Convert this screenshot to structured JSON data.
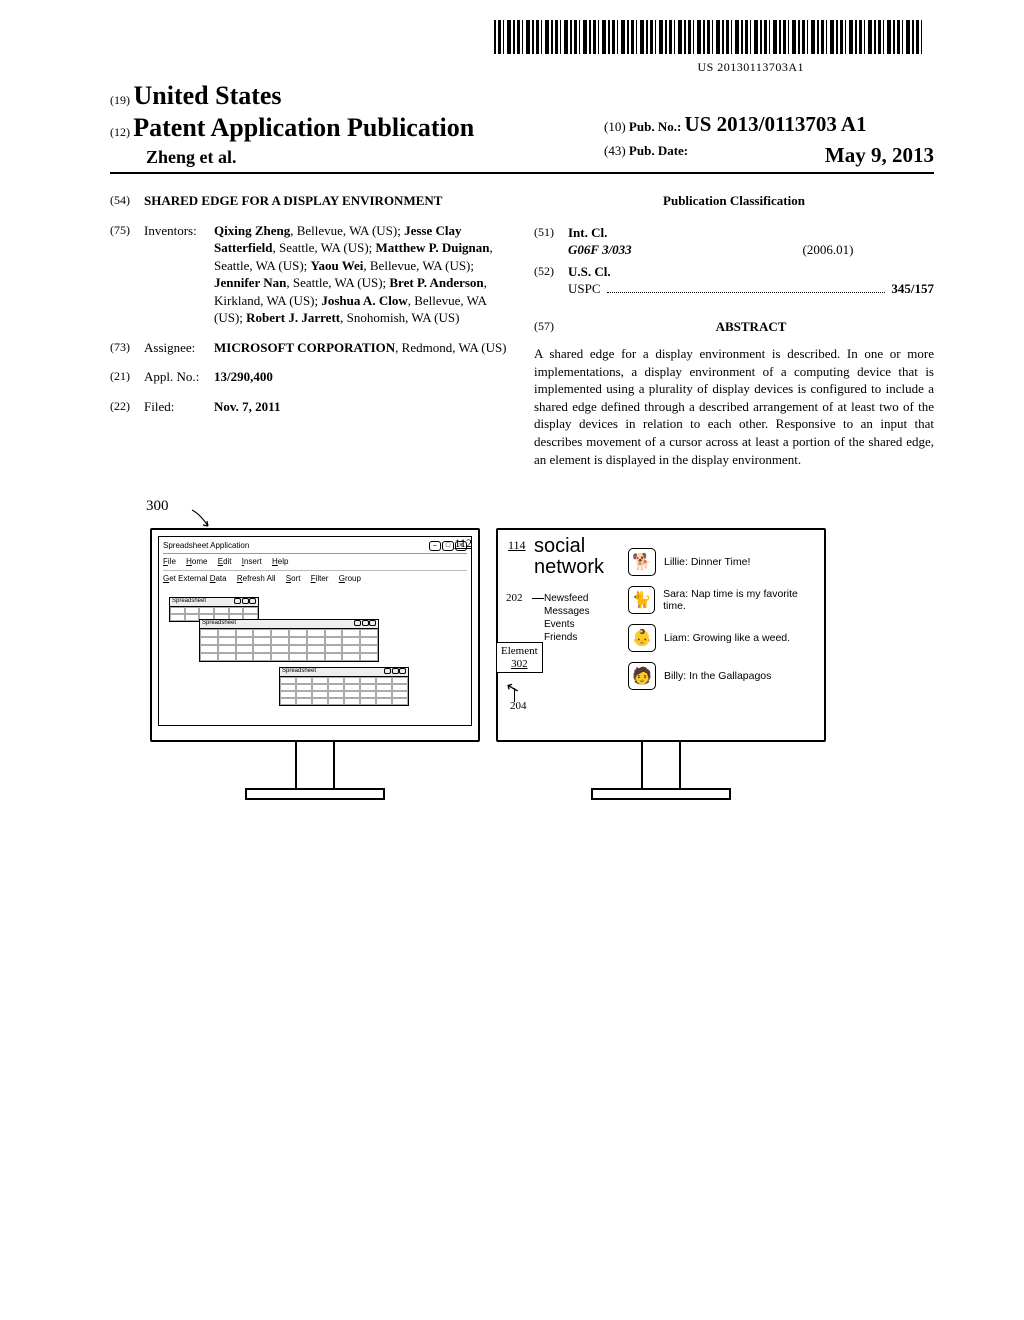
{
  "barcode_number": "US 20130113703A1",
  "header": {
    "code19": "(19)",
    "country": "United States",
    "code12": "(12)",
    "doc_type": "Patent Application Publication",
    "authors_line": "Zheng et al.",
    "code10": "(10)",
    "pubno_label": "Pub. No.:",
    "pubno_value": "US 2013/0113703 A1",
    "code43": "(43)",
    "pubdate_label": "Pub. Date:",
    "pubdate_value": "May 9, 2013"
  },
  "left": {
    "code54": "(54)",
    "title": "SHARED EDGE FOR A DISPLAY ENVIRONMENT",
    "code75": "(75)",
    "inventors_label": "Inventors:",
    "inventors": [
      {
        "name": "Qixing Zheng",
        "loc": ", Bellevue, WA (US); "
      },
      {
        "name": "Jesse Clay Satterfield",
        "loc": ", Seattle, WA (US); "
      },
      {
        "name": "Matthew P. Duignan",
        "loc": ", Seattle, WA (US); "
      },
      {
        "name": "Yaou Wei",
        "loc": ", Bellevue, WA (US); "
      },
      {
        "name": "Jennifer Nan",
        "loc": ", Seattle, WA (US); "
      },
      {
        "name": "Bret P. Anderson",
        "loc": ", Kirkland, WA (US); "
      },
      {
        "name": "Joshua A. Clow",
        "loc": ", Bellevue, WA (US); "
      },
      {
        "name": "Robert J. Jarrett",
        "loc": ", Snohomish, WA (US)"
      }
    ],
    "code73": "(73)",
    "assignee_label": "Assignee:",
    "assignee_name": "MICROSOFT CORPORATION",
    "assignee_loc": ", Redmond, WA (US)",
    "code21": "(21)",
    "applno_label": "Appl. No.:",
    "applno_value": "13/290,400",
    "code22": "(22)",
    "filed_label": "Filed:",
    "filed_value": "Nov. 7, 2011"
  },
  "right": {
    "pubclass_heading": "Publication Classification",
    "code51": "(51)",
    "intcl_label": "Int. Cl.",
    "intcl_code": "G06F 3/033",
    "intcl_date": "(2006.01)",
    "code52": "(52)",
    "uscl_label": "U.S. Cl.",
    "uspc_label": "USPC",
    "uspc_value": "345/157",
    "code57": "(57)",
    "abstract_heading": "ABSTRACT",
    "abstract_body": "A shared edge for a display environment is described. In one or more implementations, a display environment of a computing device that is implemented using a plurality of display devices is configured to include a shared edge defined through a described arrangement of at least two of the display devices in relation to each other. Responsive to an input that describes movement of a cursor across at least a portion of the shared edge, an element is displayed in the display environment."
  },
  "figure": {
    "ref300": "300",
    "ref112": "112",
    "ref114": "114",
    "ref202": "202",
    "ref204": "204",
    "element_label": "Element",
    "element_num": "302",
    "app_title": "Spreadsheet Application",
    "menu": {
      "file": "File",
      "home": "Home",
      "edit": "Edit",
      "insert": "Insert",
      "help": "Help"
    },
    "toolbar": {
      "getdata": "Get External Data",
      "refresh": "Refresh All",
      "sort": "Sort",
      "filter": "Filter",
      "group": "Group"
    },
    "sub_sheet_title": "Spreadsheet",
    "social_title_1": "social",
    "social_title_2": "network",
    "nav": {
      "newsfeed": "Newsfeed",
      "messages": "Messages",
      "events": "Events",
      "friends": "Friends"
    },
    "feed": [
      {
        "icon": "🐕",
        "text": "Lillie: Dinner Time!"
      },
      {
        "icon": "🐈",
        "text": "Sara: Nap time is my favorite time."
      },
      {
        "icon": "👶",
        "text": "Liam: Growing like a weed."
      },
      {
        "icon": "🧑",
        "text": "Billy: In the Gallapagos"
      }
    ]
  }
}
